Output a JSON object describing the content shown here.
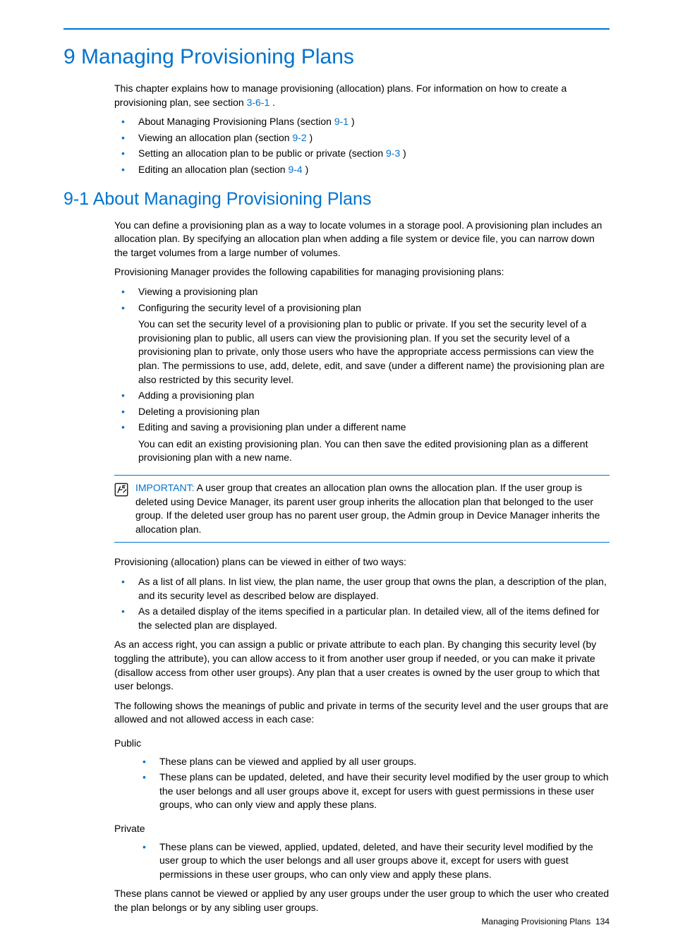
{
  "page": {
    "h1": "9 Managing Provisioning Plans",
    "intro_text": "This chapter explains how to manage provisioning (allocation) plans. For information on how to create a provisioning plan, see section ",
    "intro_link": "3-6-1",
    "intro_after": " .",
    "toc": [
      {
        "text": "About Managing Provisioning Plans (section ",
        "link": "9-1",
        "after": " )"
      },
      {
        "text": "Viewing an allocation plan (section ",
        "link": "9-2",
        "after": " )"
      },
      {
        "text": "Setting an allocation plan to be public or private (section ",
        "link": "9-3",
        "after": " )"
      },
      {
        "text": "Editing an allocation plan (section ",
        "link": "9-4",
        "after": " )"
      }
    ],
    "h2": "9-1 About Managing Provisioning Plans",
    "p1": "You can define a provisioning plan as a way to locate volumes in a storage pool. A provisioning plan includes an allocation plan. By specifying an allocation plan when adding a file system or device file, you can narrow down the target volumes from a large number of volumes.",
    "p2": "Provisioning Manager provides the following capabilities for managing provisioning plans:",
    "caps": {
      "c1": "Viewing a provisioning plan",
      "c2": "Configuring the security level of a provisioning plan",
      "c2_sub": "You can set the security level of a provisioning plan to public or private. If you set the security level of a provisioning plan to public, all users can view the provisioning plan. If you set the security level of a provisioning plan to private, only those users who have the appropriate access permissions can view the plan. The permissions to use, add, delete, edit, and save (under a different name) the provisioning plan are also restricted by this security level.",
      "c3": "Adding a provisioning plan",
      "c4": "Deleting a provisioning plan",
      "c5": "Editing and saving a provisioning plan under a different name",
      "c5_sub": "You can edit an existing provisioning plan. You can then save the edited provisioning plan as a different provisioning plan with a new name."
    },
    "important": {
      "label": "IMPORTANT:",
      "text": "  A user group that creates an allocation plan owns the allocation plan. If the user group is deleted using Device Manager, its parent user group inherits the allocation plan that belonged to the user group. If the deleted user group has no parent user group, the Admin group in Device Manager inherits the allocation plan."
    },
    "p3": "Provisioning (allocation) plans can be viewed in either of two ways:",
    "views": {
      "v1": "As a list of all plans. In list view, the plan name, the user group that owns the plan, a description of the plan, and its security level as described below are displayed.",
      "v2": "As a detailed display of the items specified in a particular plan. In detailed view, all of the items defined for the selected plan are displayed."
    },
    "p4": "As an access right, you can assign a public or private attribute to each plan. By changing this security level (by toggling the attribute), you can allow access to it from another user group if needed, or you can make it private (disallow access from other user groups). Any plan that a user creates is owned by the user group to which that user belongs.",
    "p5": "The following shows the meanings of public and private in terms of the security level and the user groups that are allowed and not allowed access in each case:",
    "public_label": "Public",
    "public_items": {
      "p1": "These plans can be viewed and applied by all user groups.",
      "p2": "These plans can be updated, deleted, and have their security level modified by the user group to which the user belongs and all user groups above it, except for users with guest permissions in these user groups, who can only view and apply these plans."
    },
    "private_label": "Private",
    "private_items": {
      "p1": "These plans can be viewed, applied, updated, deleted, and have their security level modified by the user group to which the user belongs and all user groups above it, except for users with guest permissions in these user groups, who can only view and apply these plans."
    },
    "p6": "These plans cannot be viewed or applied by any user groups under the user group to which the user who created the plan belongs or by any sibling user groups.",
    "footer_text": "Managing Provisioning Plans",
    "footer_page": "134"
  }
}
